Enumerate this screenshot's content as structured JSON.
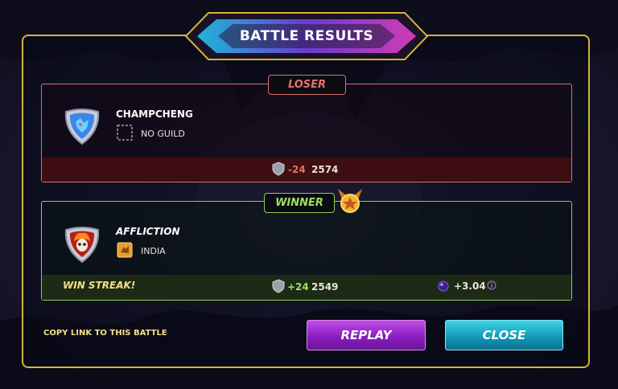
{
  "title": "BATTLE RESULTS",
  "loser": {
    "tag": "LOSER",
    "name": "CHAMPCHENG",
    "guild": "NO GUILD",
    "rating_change": "-24",
    "rating": "2574"
  },
  "winner": {
    "tag": "WINNER",
    "name": "AFFLICTION",
    "guild": "INDIA",
    "streak_text": "WIN STREAK!",
    "rating_change": "+24",
    "rating": "2549",
    "reward": "+3.04"
  },
  "footer": {
    "copy_link": "COPY LINK TO THIS BATTLE",
    "replay": "REPLAY",
    "close": "CLOSE"
  },
  "colors": {
    "panel_border": "#d4b43a",
    "loser": "#e8706b",
    "winner": "#9be060",
    "replay": "#8a1ec0",
    "close": "#149ab8"
  },
  "icons": {
    "loser_avatar": "blue-dragon-avatar-icon",
    "winner_avatar": "flaming-skull-avatar-icon",
    "no_guild": "empty-guild-icon",
    "winner_guild": "guild-banner-icon",
    "rating": "shield-rating-icon",
    "reward": "dark-energy-orb-icon",
    "info": "info-icon",
    "trophy": "trophy-medal-icon"
  }
}
